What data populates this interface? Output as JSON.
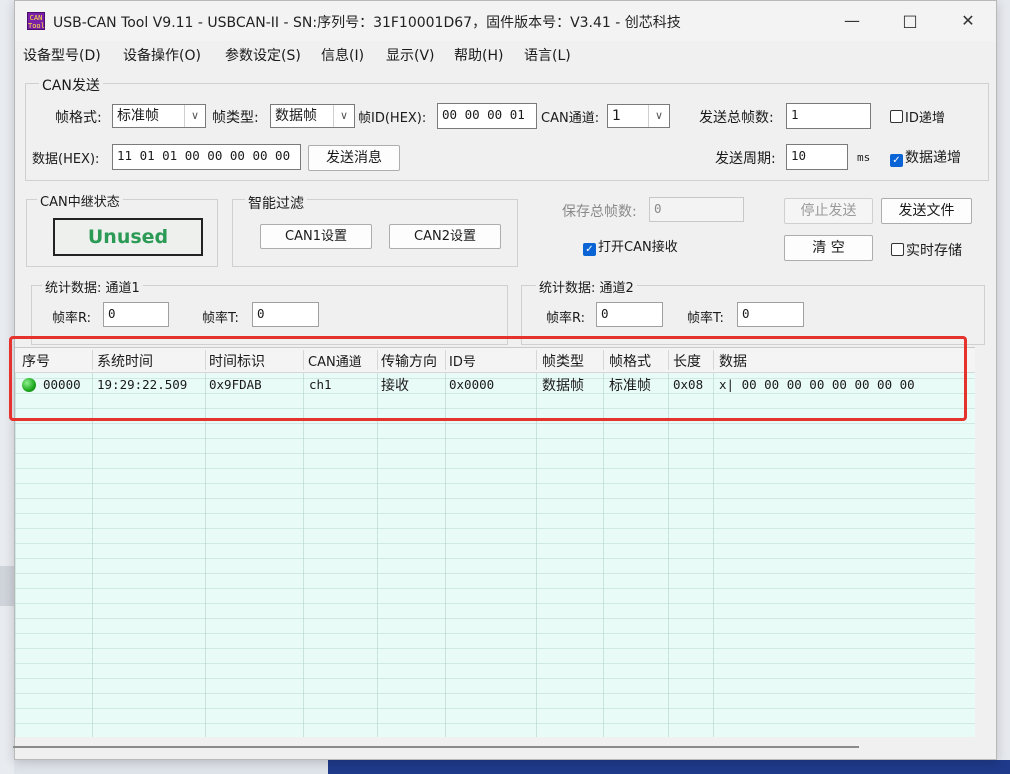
{
  "window": {
    "title": "USB-CAN Tool V9.11 - USBCAN-II - SN:序列号：31F10001D67，固件版本号：V3.41 - 创芯科技",
    "icon_text": "CAN Tool"
  },
  "menu": [
    "设备型号(D)",
    "设备操作(O)",
    "参数设定(S)",
    "信息(I)",
    "显示(V)",
    "帮助(H)",
    "语言(L)"
  ],
  "can_send": {
    "group_title": "CAN发送",
    "frame_format_label": "帧格式:",
    "frame_format_value": "标准帧",
    "frame_type_label": "帧类型:",
    "frame_type_value": "数据帧",
    "frame_id_label": "帧ID(HEX):",
    "frame_id_value": "00 00 00 01",
    "channel_label": "CAN通道:",
    "channel_value": "1",
    "total_frames_label": "发送总帧数:",
    "total_frames_value": "1",
    "id_increment_label": "ID递增",
    "id_increment_checked": false,
    "data_label": "数据(HEX):",
    "data_value": "11 01 01 00 00 00 00 00",
    "send_button": "发送消息",
    "period_label": "发送周期:",
    "period_value": "10",
    "period_unit": "ms",
    "data_increment_label": "数据递增",
    "data_increment_checked": true
  },
  "relay": {
    "group_title": "CAN中继状态",
    "status": "Unused",
    "status_color": "#2a9a55"
  },
  "filter": {
    "group_title": "智能过滤",
    "can1_button": "CAN1设置",
    "can2_button": "CAN2设置"
  },
  "controls": {
    "saved_total_label": "保存总帧数:",
    "saved_total_value": "0",
    "open_can_label": "打开CAN接收",
    "open_can_checked": true,
    "stop_send_button": "停止发送",
    "send_file_button": "发送文件",
    "clear_button": "清 空",
    "realtime_save_label": "实时存储",
    "realtime_save_checked": false
  },
  "stats1": {
    "title": "统计数据: 通道1",
    "rx_label": "帧率R:",
    "rx_value": "0",
    "tx_label": "帧率T:",
    "tx_value": "0"
  },
  "stats2": {
    "title": "统计数据: 通道2",
    "rx_label": "帧率R:",
    "rx_value": "0",
    "tx_label": "帧率T:",
    "tx_value": "0"
  },
  "table": {
    "headers": [
      "序号",
      "系统时间",
      "时间标识",
      "CAN通道",
      "传输方向",
      "ID号",
      "帧类型",
      "帧格式",
      "长度",
      "数据"
    ],
    "rows": [
      {
        "index": "00000",
        "system_time": "19:29:22.509",
        "timestamp": "0x9FDAB",
        "channel": "ch1",
        "direction": "接收",
        "id": "0x0000",
        "frame_type": "数据帧",
        "frame_format": "标准帧",
        "length": "0x08",
        "data": "x| 00 00 00 00 00 00 00 00",
        "status_color": "#1da81d"
      }
    ]
  },
  "highlight_color": "#e5322d"
}
